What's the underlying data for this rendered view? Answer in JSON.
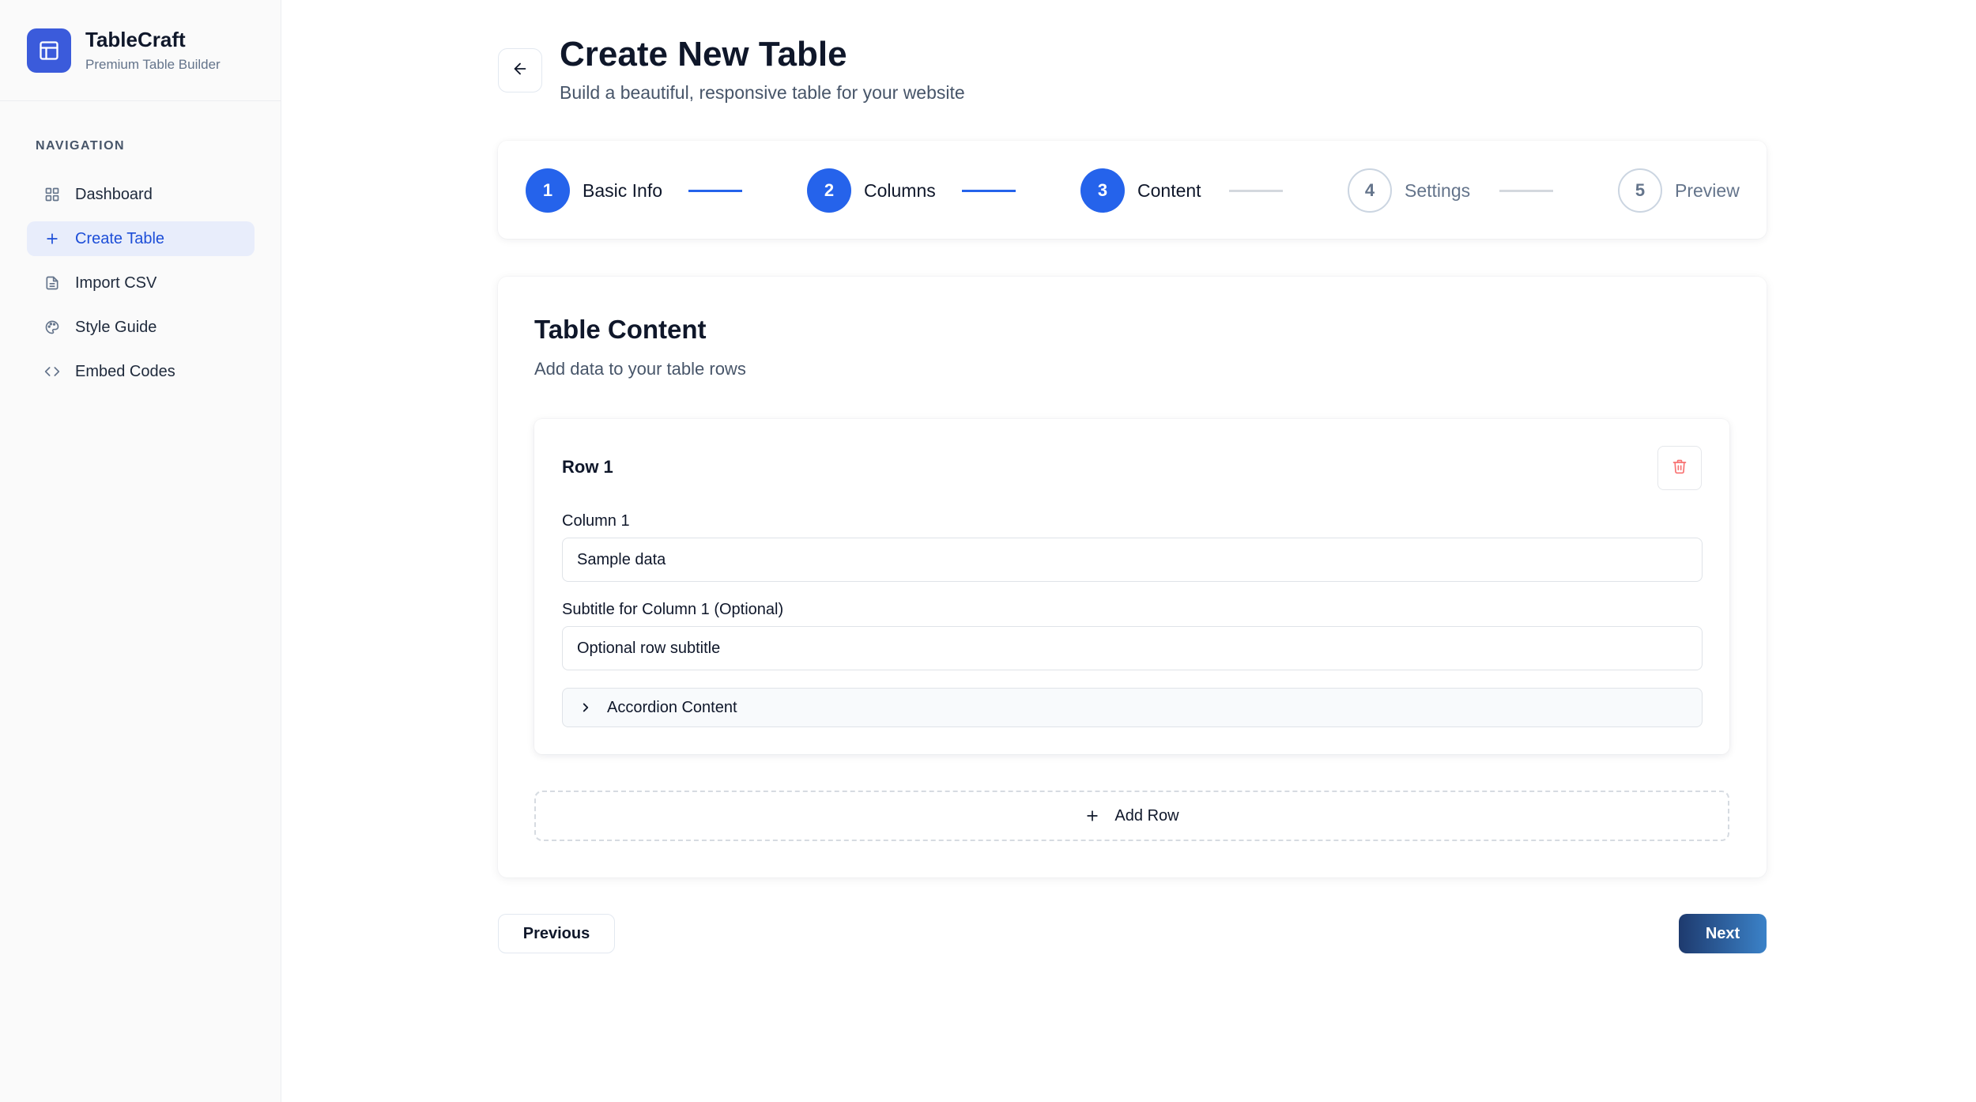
{
  "brand": {
    "name": "TableCraft",
    "subtitle": "Premium Table Builder",
    "logo_icon": "table-icon",
    "accent": "#3b5bdb"
  },
  "sidebar": {
    "section_label": "NAVIGATION",
    "items": [
      {
        "label": "Dashboard",
        "icon": "grid-icon",
        "active": false
      },
      {
        "label": "Create Table",
        "icon": "plus-icon",
        "active": true
      },
      {
        "label": "Import CSV",
        "icon": "file-icon",
        "active": false
      },
      {
        "label": "Style Guide",
        "icon": "palette-icon",
        "active": false
      },
      {
        "label": "Embed Codes",
        "icon": "code-icon",
        "active": false
      }
    ]
  },
  "header": {
    "title": "Create New Table",
    "subtitle": "Build a beautiful, responsive table for your website"
  },
  "stepper": {
    "current_step": 3,
    "steps": [
      {
        "number": "1",
        "label": "Basic Info",
        "status": "done"
      },
      {
        "number": "2",
        "label": "Columns",
        "status": "done"
      },
      {
        "number": "3",
        "label": "Content",
        "status": "active"
      },
      {
        "number": "4",
        "label": "Settings",
        "status": "todo"
      },
      {
        "number": "5",
        "label": "Preview",
        "status": "todo"
      }
    ],
    "active_color": "#2563eb"
  },
  "content": {
    "title": "Table Content",
    "subtitle": "Add data to your table rows",
    "rows": [
      {
        "title": "Row 1",
        "column_label": "Column 1",
        "column_value": "Sample data",
        "subtitle_label": "Subtitle for Column 1 (Optional)",
        "subtitle_value": "Optional row subtitle",
        "accordion_label": "Accordion Content"
      }
    ],
    "add_row_label": "Add Row"
  },
  "footer": {
    "previous_label": "Previous",
    "next_label": "Next"
  }
}
